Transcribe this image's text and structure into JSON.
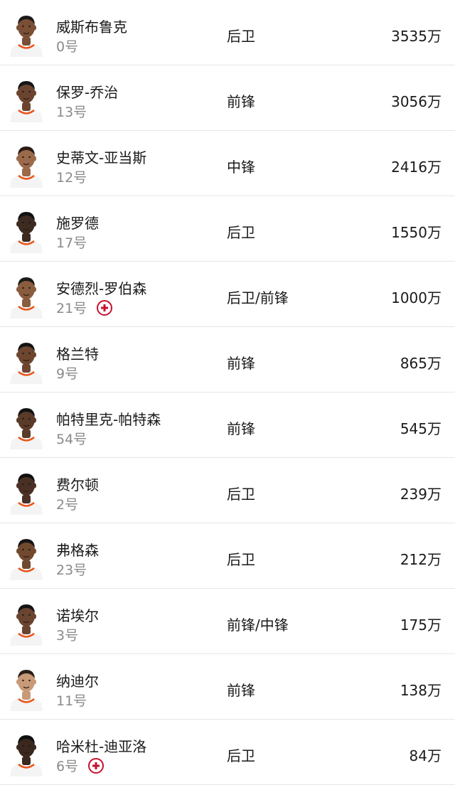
{
  "colors": {
    "injury_red": "#c8102e",
    "jersey_white": "#f4f4f4",
    "jersey_trim": "#e8551b",
    "text_primary": "#1a1a1a",
    "text_secondary": "#8a8a8a"
  },
  "players": [
    {
      "name": "威斯布鲁克",
      "number": "0号",
      "position": "后卫",
      "salary": "3535万",
      "injured": false,
      "skin": "#7a4f35",
      "hair": "#1b1b1b"
    },
    {
      "name": "保罗-乔治",
      "number": "13号",
      "position": "前锋",
      "salary": "3056万",
      "injured": false,
      "skin": "#6b4430",
      "hair": "#151515"
    },
    {
      "name": "史蒂文-亚当斯",
      "number": "12号",
      "position": "中锋",
      "salary": "2416万",
      "injured": false,
      "skin": "#9a6a4a",
      "hair": "#2a1c14"
    },
    {
      "name": "施罗德",
      "number": "17号",
      "position": "后卫",
      "salary": "1550万",
      "injured": false,
      "skin": "#3d2a20",
      "hair": "#111111"
    },
    {
      "name": "安德烈-罗伯森",
      "number": "21号",
      "position": "后卫/前锋",
      "salary": "1000万",
      "injured": true,
      "skin": "#8a5c3e",
      "hair": "#1a1a1a"
    },
    {
      "name": "格兰特",
      "number": "9号",
      "position": "前锋",
      "salary": "865万",
      "injured": false,
      "skin": "#6e4630",
      "hair": "#141414"
    },
    {
      "name": "帕特里克-帕特森",
      "number": "54号",
      "position": "前锋",
      "salary": "545万",
      "injured": false,
      "skin": "#5a3a28",
      "hair": "#121212"
    },
    {
      "name": "费尔顿",
      "number": "2号",
      "position": "后卫",
      "salary": "239万",
      "injured": false,
      "skin": "#4a3024",
      "hair": "#101010"
    },
    {
      "name": "弗格森",
      "number": "23号",
      "position": "后卫",
      "salary": "212万",
      "injured": false,
      "skin": "#70492f",
      "hair": "#151515"
    },
    {
      "name": "诺埃尔",
      "number": "3号",
      "position": "前锋/中锋",
      "salary": "175万",
      "injured": false,
      "skin": "#6a4430",
      "hair": "#131313"
    },
    {
      "name": "纳迪尔",
      "number": "11号",
      "position": "前锋",
      "salary": "138万",
      "injured": false,
      "skin": "#c99a78",
      "hair": "#2a1f18"
    },
    {
      "name": "哈米杜-迪亚洛",
      "number": "6号",
      "position": "后卫",
      "salary": "84万",
      "injured": true,
      "skin": "#3a271d",
      "hair": "#0f0f0f"
    }
  ]
}
